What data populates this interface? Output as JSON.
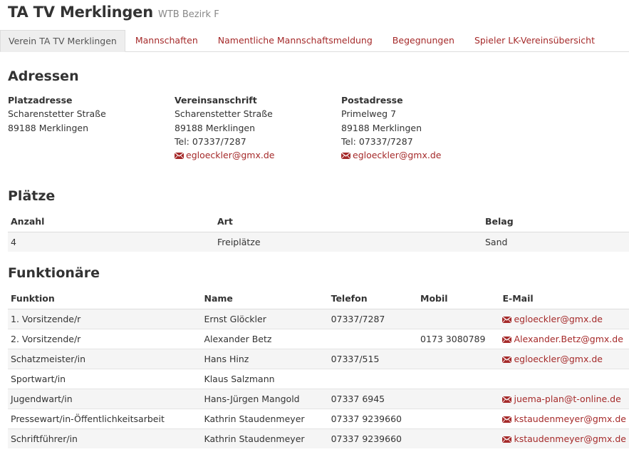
{
  "header": {
    "title": "TA TV Merklingen",
    "subtitle": "WTB Bezirk F"
  },
  "tabs": [
    {
      "label": "Verein TA TV Merklingen",
      "active": true
    },
    {
      "label": "Mannschaften",
      "active": false
    },
    {
      "label": "Namentliche Mannschaftsmeldung",
      "active": false
    },
    {
      "label": "Begegnungen",
      "active": false
    },
    {
      "label": "Spieler LK-Vereinsübersicht",
      "active": false
    }
  ],
  "addresses": {
    "heading": "Adressen",
    "platz": {
      "label": "Platzadresse",
      "street": "Scharenstetter Straße",
      "city": "89188 Merklingen"
    },
    "verein": {
      "label": "Vereinsanschrift",
      "street": "Scharenstetter Straße",
      "city": "89188 Merklingen",
      "tel": "Tel: 07337/7287",
      "email": "egloeckler@gmx.de"
    },
    "post": {
      "label": "Postadresse",
      "street": "Primelweg 7",
      "city": "89188 Merklingen",
      "tel": "Tel: 07337/7287",
      "email": "egloeckler@gmx.de"
    }
  },
  "plaetze": {
    "heading": "Plätze",
    "headers": [
      "Anzahl",
      "Art",
      "Belag"
    ],
    "rows": [
      [
        "4",
        "Freiplätze",
        "Sand"
      ]
    ]
  },
  "funktionaere": {
    "heading": "Funktionäre",
    "headers": [
      "Funktion",
      "Name",
      "Telefon",
      "Mobil",
      "E-Mail"
    ],
    "rows": [
      [
        "1. Vorsitzende/r",
        "Ernst Glöckler",
        "07337/7287",
        "",
        "egloeckler@gmx.de"
      ],
      [
        "2. Vorsitzende/r",
        "Alexander Betz",
        "",
        "0173 3080789",
        "Alexander.Betz@gmx.de"
      ],
      [
        "Schatzmeister/in",
        "Hans Hinz",
        "07337/515",
        "",
        "egloeckler@gmx.de"
      ],
      [
        "Sportwart/in",
        "Klaus Salzmann",
        "",
        "",
        ""
      ],
      [
        "Jugendwart/in",
        "Hans-Jürgen Mangold",
        "07337 6945",
        "",
        "juema-plan@t-online.de"
      ],
      [
        "Pressewart/in-Öffentlichkeitsarbeit",
        "Kathrin Staudenmeyer",
        "07337 9239660",
        "",
        "kstaudenmeyer@gmx.de"
      ],
      [
        "Schriftführer/in",
        "Kathrin Staudenmeyer",
        "07337 9239660",
        "",
        "kstaudenmeyer@gmx.de"
      ]
    ]
  },
  "colors": {
    "link": "#a52a2a",
    "tab_active_bg": "#eeeeee",
    "row_alt_bg": "#f5f5f5"
  }
}
